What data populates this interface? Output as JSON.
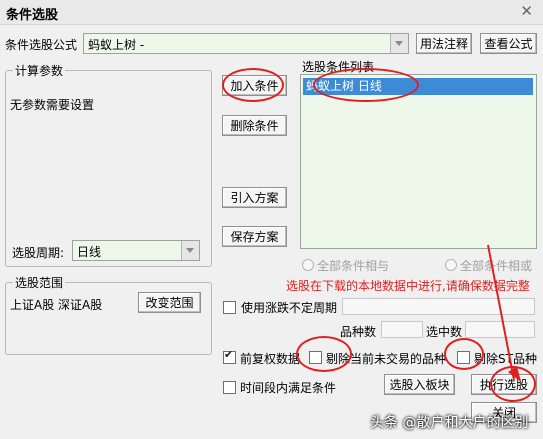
{
  "window": {
    "title": "条件选股"
  },
  "top": {
    "formula_label": "条件选股公式",
    "formula_value": "蚂蚁上树          -",
    "usage_button": "用法注释",
    "view_formula_button": "查看公式"
  },
  "params": {
    "group_title": "计算参数",
    "no_params": "无参数需要设置",
    "period_label": "选股周期:",
    "period_value": "日线"
  },
  "actions": {
    "add": "加入条件",
    "delete": "删除条件",
    "import": "引入方案",
    "save": "保存方案"
  },
  "conditions": {
    "list_title": "选股条件列表",
    "items": [
      "蚂蚁上树  日线"
    ],
    "and_option": "全部条件相与",
    "or_option": "全部条件相或",
    "notice": "选股在下载的本地数据中进行,请确保数据完整"
  },
  "range": {
    "group_title": "选股范围",
    "value": "上证A股 深证A股",
    "change_button": "改变范围"
  },
  "options": {
    "use_indefinite_period": "使用涨跌不定周期",
    "stock_count_label": "品种数",
    "selected_count_label": "选中数",
    "pre_adjusted": "前复权数据",
    "exclude_untraded": "剔除当前未交易的品种",
    "exclude_st": "剔除ST品种",
    "time_range": "时间段内满足条件"
  },
  "bottom": {
    "to_block": "选股入板块",
    "execute": "执行选股",
    "close": "关闭"
  },
  "watermark": "头条 @散户和大户的区别",
  "colors": {
    "annotation": "#e02020",
    "list_bg": "#eef8ea",
    "selected_bg": "#3d8bd6",
    "notice": "#e02020"
  }
}
